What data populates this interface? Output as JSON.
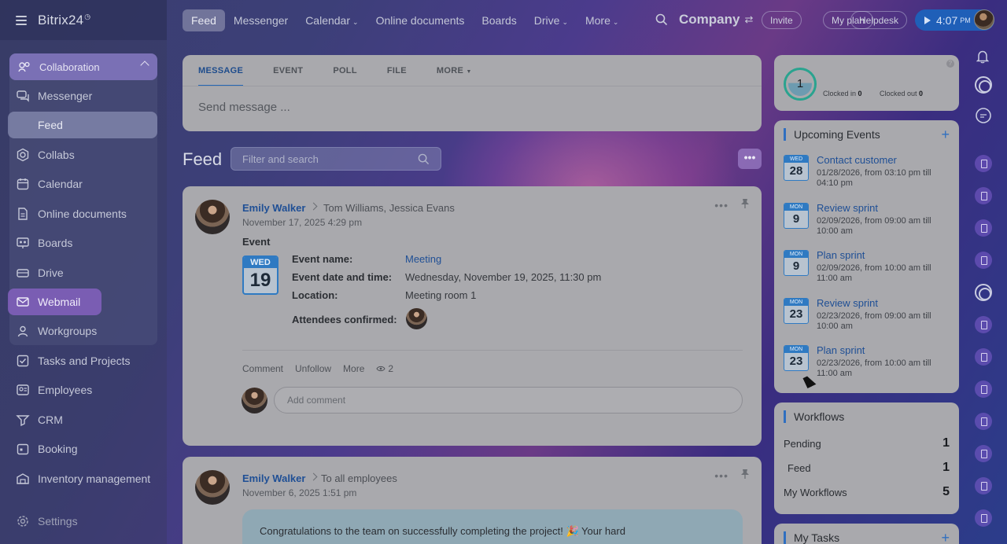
{
  "app": {
    "logo": "Bitrix24",
    "logo_mark": "◷"
  },
  "topnav": {
    "items": [
      {
        "label": "Feed",
        "active": true,
        "dropdown": false
      },
      {
        "label": "Messenger",
        "dropdown": false
      },
      {
        "label": "Calendar",
        "dropdown": true
      },
      {
        "label": "Online documents",
        "dropdown": false
      },
      {
        "label": "Boards",
        "dropdown": false
      },
      {
        "label": "Drive",
        "dropdown": true
      },
      {
        "label": "More",
        "dropdown": true
      }
    ],
    "company": "Company",
    "company_switch_icon": "⇄",
    "invite": "Invite",
    "my_plan": "My plan",
    "helpdesk": "Helpdesk",
    "clock_time": "4:07",
    "clock_ampm": "PM"
  },
  "sidebar": {
    "section": "Collaboration",
    "items": [
      {
        "label": "Messenger",
        "icon": "chat-icon"
      },
      {
        "label": "Feed",
        "icon": "feed-icon",
        "active": true
      },
      {
        "label": "Collabs",
        "icon": "hexagon-icon"
      },
      {
        "label": "Calendar",
        "icon": "calendar-icon"
      },
      {
        "label": "Online documents",
        "icon": "document-icon"
      },
      {
        "label": "Boards",
        "icon": "board-icon"
      },
      {
        "label": "Drive",
        "icon": "drive-icon"
      },
      {
        "label": "Webmail",
        "icon": "mail-icon",
        "highlighted": true
      },
      {
        "label": "Workgroups",
        "icon": "group-icon"
      },
      {
        "label": "Tasks and Projects",
        "icon": "tasks-icon"
      },
      {
        "label": "Employees",
        "icon": "employees-icon"
      },
      {
        "label": "CRM",
        "icon": "crm-icon"
      },
      {
        "label": "Booking",
        "icon": "booking-icon"
      },
      {
        "label": "Inventory management",
        "icon": "inventory-icon"
      },
      {
        "label": "Settings",
        "icon": "gear-icon"
      }
    ]
  },
  "composer": {
    "tabs": [
      "MESSAGE",
      "EVENT",
      "POLL",
      "FILE",
      "MORE"
    ],
    "placeholder": "Send message ..."
  },
  "feed": {
    "title": "Feed",
    "search_placeholder": "Filter and search",
    "more": "•••"
  },
  "posts": [
    {
      "author": "Emily Walker",
      "to": "Tom Williams, Jessica Evans",
      "date": "November 17, 2025 4:29 pm",
      "type_label": "Event",
      "calendar_weekday": "WED",
      "calendar_day": "19",
      "fields": [
        {
          "key": "Event name:",
          "value": "Meeting",
          "link": true
        },
        {
          "key": "Event date and time:",
          "value": "Wednesday, November 19, 2025, 11:30 pm"
        },
        {
          "key": "Location:",
          "value": "Meeting room 1"
        },
        {
          "key": "Attendees confirmed:",
          "value": ""
        }
      ],
      "actions": [
        "Comment",
        "Unfollow",
        "More"
      ],
      "views": "2",
      "comment_placeholder": "Add comment"
    },
    {
      "author": "Emily Walker",
      "to": "To all employees",
      "date": "November 6, 2025 1:51 pm",
      "text": "Congratulations to the team on successfully completing the project! 🎉 Your hard"
    }
  ],
  "timeman": {
    "count": "1",
    "clocked_in_label": "Clocked in",
    "clocked_in_value": "0",
    "clocked_out_label": "Clocked out",
    "clocked_out_value": "0"
  },
  "upcoming": {
    "title": "Upcoming Events",
    "events": [
      {
        "weekday": "WED",
        "day": "28",
        "title": "Contact customer",
        "time": "01/28/2026, from 03:10 pm till 04:10 pm"
      },
      {
        "weekday": "MON",
        "day": "9",
        "title": "Review sprint",
        "time": "02/09/2026, from 09:00 am till 10:00 am"
      },
      {
        "weekday": "MON",
        "day": "9",
        "title": "Plan sprint",
        "time": "02/09/2026, from 10:00 am till 11:00 am"
      },
      {
        "weekday": "MON",
        "day": "23",
        "title": "Review sprint",
        "time": "02/23/2026, from 09:00 am till 10:00 am"
      },
      {
        "weekday": "MON",
        "day": "23",
        "title": "Plan sprint",
        "time": "02/23/2026, from 10:00 am till 11:00 am"
      }
    ]
  },
  "workflows": {
    "title": "Workflows",
    "rows": [
      {
        "label": "Pending",
        "value": "1"
      },
      {
        "label": "Feed",
        "value": "1"
      },
      {
        "label": "My Workflows",
        "value": "5"
      }
    ]
  },
  "my_tasks": {
    "title": "My Tasks"
  }
}
